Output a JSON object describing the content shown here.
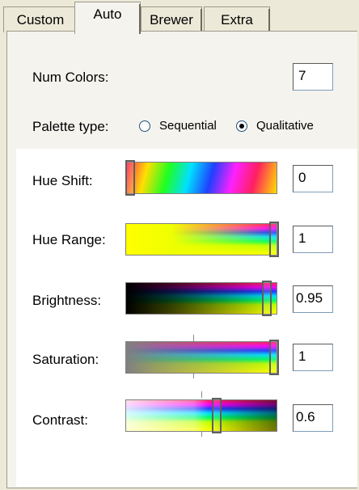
{
  "tabs": [
    {
      "label": "Custom",
      "selected": false
    },
    {
      "label": "Auto",
      "selected": true
    },
    {
      "label": "Brewer",
      "selected": false
    },
    {
      "label": "Extra",
      "selected": false
    }
  ],
  "num_colors": {
    "label": "Num Colors:",
    "value": "7"
  },
  "palette_type": {
    "label": "Palette type:",
    "options": [
      {
        "label": "Sequential",
        "selected": false
      },
      {
        "label": "Qualitative",
        "selected": true
      }
    ]
  },
  "sliders": [
    {
      "label": "Hue Shift:",
      "value": "0",
      "position": 0.0
    },
    {
      "label": "Hue Range:",
      "value": "1",
      "position": 1.0
    },
    {
      "label": "Brightness:",
      "value": "0.95",
      "position": 0.95
    },
    {
      "label": "Saturation:",
      "value": "1",
      "position": 1.0
    },
    {
      "label": "Contrast:",
      "value": "0.6",
      "position": 0.6
    }
  ]
}
